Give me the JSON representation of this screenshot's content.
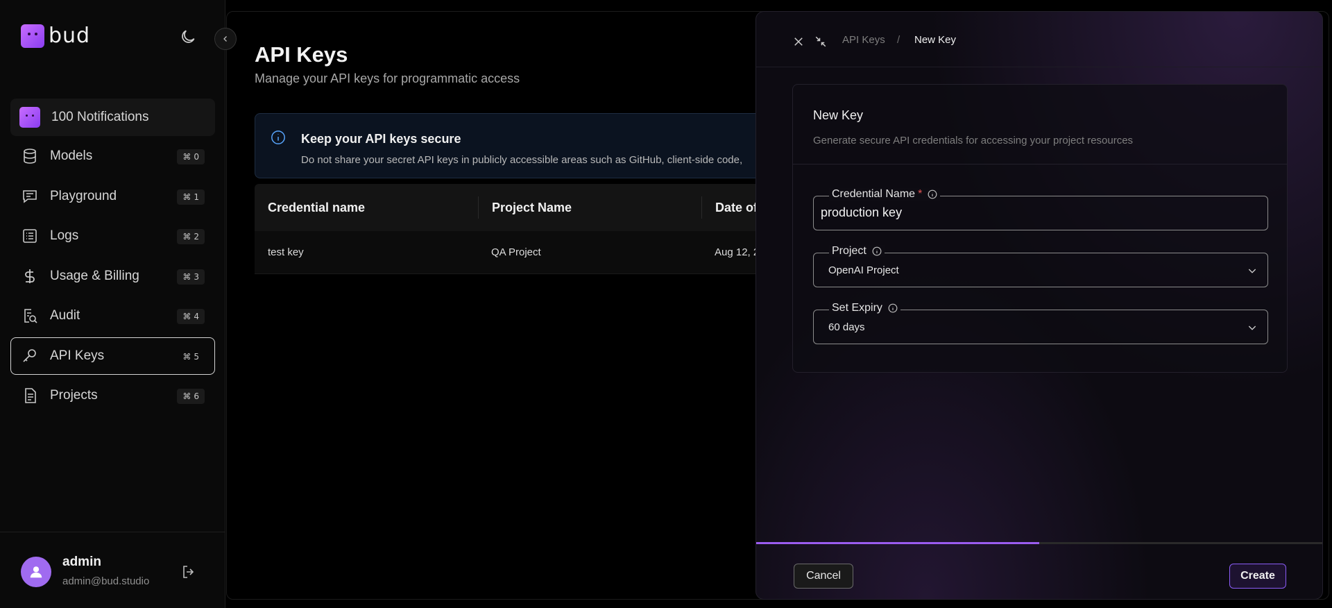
{
  "sidebar": {
    "logo_text": "bud",
    "notifications_label": "100 Notifications",
    "items": [
      {
        "label": "Models",
        "shortcut": "0",
        "icon": "database-icon"
      },
      {
        "label": "Playground",
        "shortcut": "1",
        "icon": "chat-icon"
      },
      {
        "label": "Logs",
        "shortcut": "2",
        "icon": "list-icon"
      },
      {
        "label": "Usage & Billing",
        "shortcut": "3",
        "icon": "dollar-icon"
      },
      {
        "label": "Audit",
        "shortcut": "4",
        "icon": "audit-icon"
      },
      {
        "label": "API Keys",
        "shortcut": "5",
        "icon": "key-icon",
        "active": true
      },
      {
        "label": "Projects",
        "shortcut": "6",
        "icon": "document-icon"
      }
    ],
    "shortcut_symbol": "⌘"
  },
  "profile": {
    "name": "admin",
    "email": "admin@bud.studio"
  },
  "main": {
    "title": "API Keys",
    "subtitle": "Manage your API keys for programmatic access",
    "banner": {
      "title": "Keep your API keys secure",
      "text": "Do not share your secret API keys in publicly accessible areas such as GitHub, client-side code,"
    },
    "table": {
      "headers": [
        "Credential name",
        "Project Name",
        "Date of"
      ],
      "rows": [
        [
          "test key",
          "QA Project",
          "Aug 12, 2"
        ]
      ]
    }
  },
  "drawer": {
    "breadcrumb": [
      "API Keys",
      "/",
      "New Key"
    ],
    "card_title": "New Key",
    "card_subtitle": "Generate secure API credentials for accessing your project resources",
    "fields": {
      "credential_label": "Credential Name",
      "credential_required": "*",
      "credential_value": "production key",
      "project_label": "Project",
      "project_value": "OpenAI Project",
      "expiry_label": "Set Expiry",
      "expiry_value": "60 days"
    },
    "progress": 0.5,
    "cancel_label": "Cancel",
    "create_label": "Create"
  },
  "colors": {
    "accent": "#9b5cf0",
    "banner_icon": "#58a6ff",
    "required": "#e25555"
  }
}
